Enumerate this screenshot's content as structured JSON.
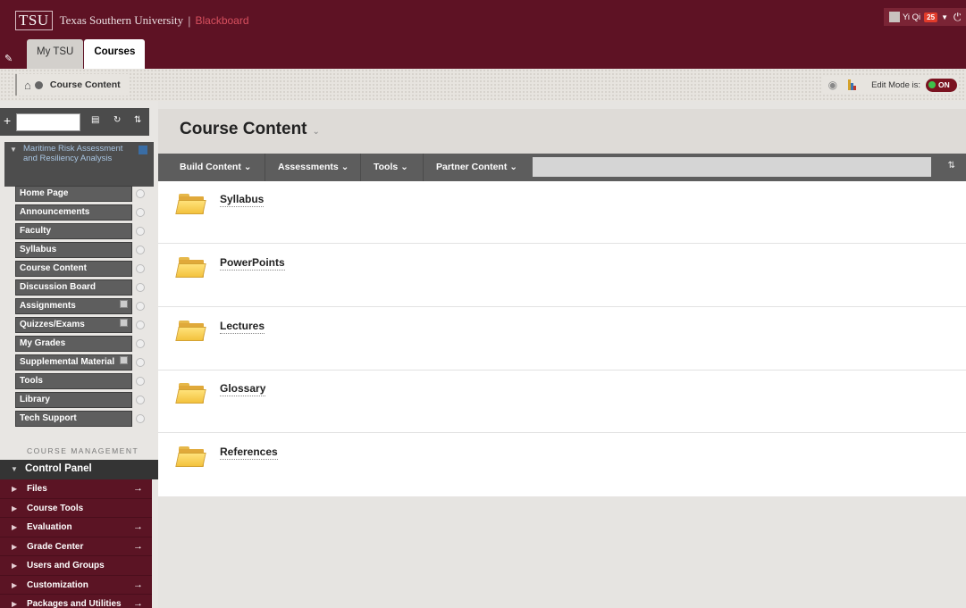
{
  "header": {
    "logo": "TSU",
    "university": "Texas Southern University",
    "separator": "|",
    "product": "Blackboard",
    "tabs": [
      {
        "label": "My TSU",
        "active": false
      },
      {
        "label": "Courses",
        "active": true
      }
    ],
    "user": {
      "name": "Yi Qi",
      "notifications": "25"
    }
  },
  "breadcrumb": {
    "current": "Course Content",
    "edit_mode_label": "Edit Mode is:",
    "edit_mode_value": "ON"
  },
  "sidebar": {
    "course_title": "Maritime Risk Assessment and Resiliency Analysis",
    "menu": [
      {
        "label": "Home Page"
      },
      {
        "label": "Announcements"
      },
      {
        "label": "Faculty"
      },
      {
        "label": "Syllabus"
      },
      {
        "label": "Course Content"
      },
      {
        "label": "Discussion Board"
      },
      {
        "label": "Assignments"
      },
      {
        "label": "Quizzes/Exams"
      },
      {
        "label": "My Grades"
      },
      {
        "label": "Supplemental Material"
      },
      {
        "label": "Tools"
      },
      {
        "label": "Library"
      },
      {
        "label": "Tech Support"
      }
    ],
    "course_management_label": "COURSE MANAGEMENT",
    "control_panel": {
      "title": "Control Panel",
      "items": [
        {
          "label": "Files"
        },
        {
          "label": "Course Tools"
        },
        {
          "label": "Evaluation"
        },
        {
          "label": "Grade Center"
        },
        {
          "label": "Users and Groups"
        },
        {
          "label": "Customization"
        },
        {
          "label": "Packages and Utilities"
        }
      ]
    }
  },
  "main": {
    "title": "Course Content",
    "actions": [
      {
        "label": "Build Content"
      },
      {
        "label": "Assessments"
      },
      {
        "label": "Tools"
      },
      {
        "label": "Partner Content"
      }
    ],
    "items": [
      {
        "label": "Syllabus"
      },
      {
        "label": "PowerPoints"
      },
      {
        "label": "Lectures"
      },
      {
        "label": "Glossary"
      },
      {
        "label": "References"
      }
    ]
  },
  "colors": {
    "header_bg": "#5e1224",
    "control_panel_bg": "#5b1424",
    "toggle_on": "#3ec24a",
    "folder": "#f3c23e"
  }
}
